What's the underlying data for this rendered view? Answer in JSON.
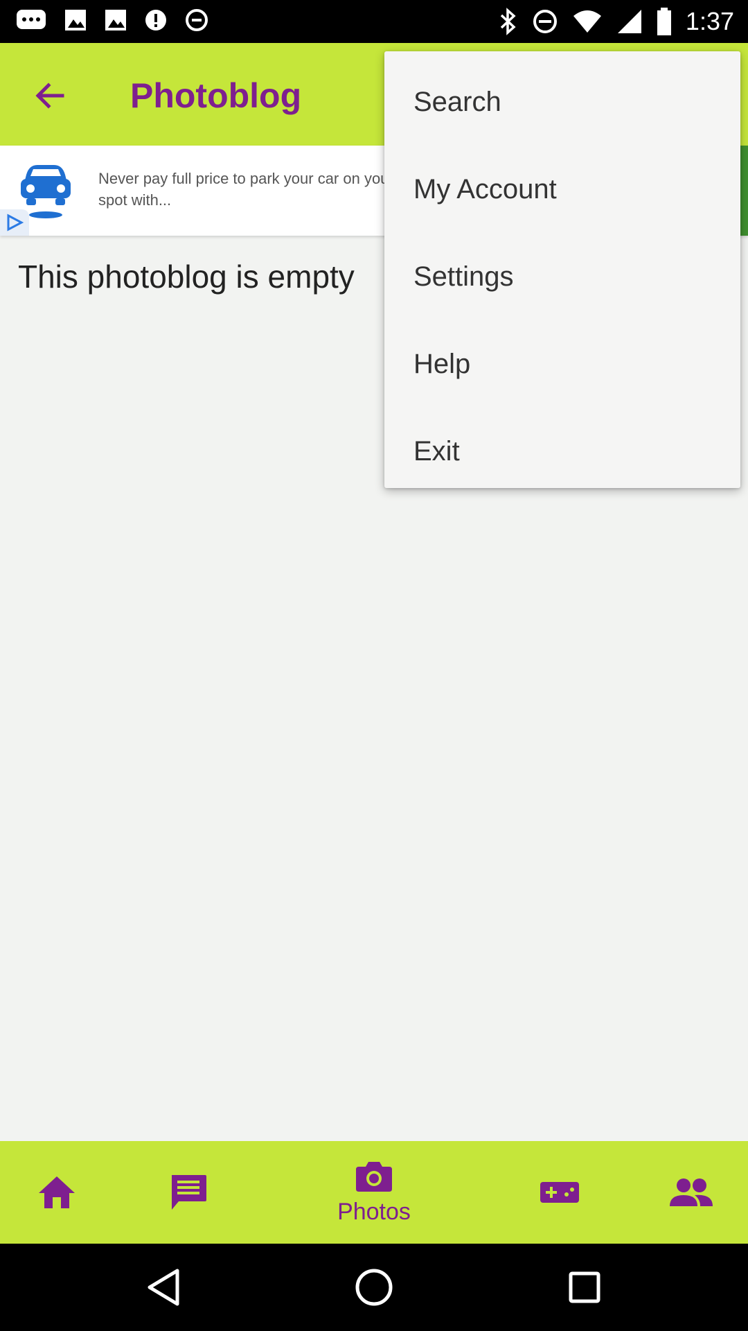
{
  "status_bar": {
    "time": "1:37",
    "left_icons": [
      "chat-icon",
      "photo-icon",
      "photo-icon",
      "alert-icon",
      "block-icon"
    ],
    "right_icons": [
      "bluetooth-icon",
      "dnd-icon",
      "wifi-icon",
      "signal-icon",
      "battery-icon"
    ]
  },
  "app_bar": {
    "title": "Photoblog",
    "back_icon": "arrow-back-icon"
  },
  "ad": {
    "text": "Never pay full price to park your car on your first spot with..."
  },
  "main": {
    "empty_message": "This photoblog is empty"
  },
  "menu": {
    "items": [
      {
        "label": "Search"
      },
      {
        "label": "My Account"
      },
      {
        "label": "Settings"
      },
      {
        "label": "Help"
      },
      {
        "label": "Exit"
      }
    ]
  },
  "bottom_nav": {
    "items": [
      {
        "icon": "home-icon"
      },
      {
        "icon": "message-icon"
      },
      {
        "icon": "camera-icon",
        "label": "Photos",
        "active": true
      },
      {
        "icon": "game-icon"
      },
      {
        "icon": "people-icon"
      }
    ]
  },
  "colors": {
    "accent_green": "#c5e63a",
    "brand_purple": "#7e1f8f"
  }
}
